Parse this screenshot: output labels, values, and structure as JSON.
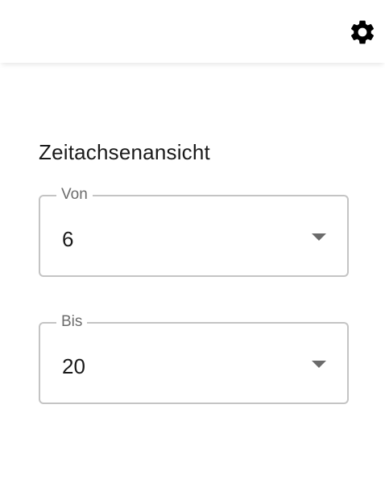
{
  "header": {
    "settings_icon": "gear-icon"
  },
  "timeline_view": {
    "title": "Zeitachsenansicht",
    "from": {
      "label": "Von",
      "value": "6"
    },
    "to": {
      "label": "Bis",
      "value": "20"
    }
  }
}
